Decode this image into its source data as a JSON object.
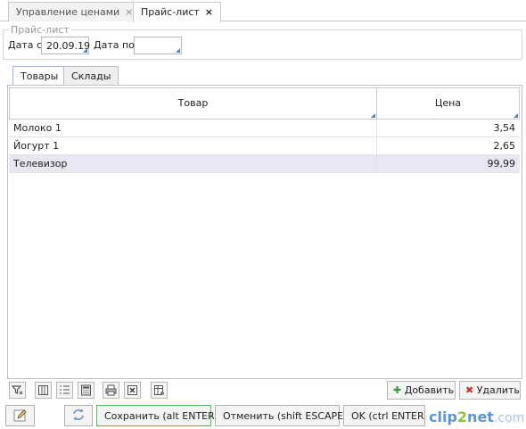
{
  "tabs": [
    {
      "label": "Управление ценами",
      "close": "×",
      "active": false
    },
    {
      "label": "Прайс-лист",
      "close": "×",
      "active": true
    }
  ],
  "form": {
    "legend": "Прайс-лист",
    "date_from_label": "Дата с",
    "date_from_value": "20.09.19",
    "date_to_label": "Дата по",
    "date_to_value": ""
  },
  "inner_tabs": [
    {
      "label": "Товары",
      "active": true
    },
    {
      "label": "Склады",
      "active": false
    }
  ],
  "grid": {
    "columns": [
      "Товар",
      "Цена"
    ],
    "rows": [
      {
        "item": "Молоко 1",
        "price": "3,54",
        "selected": false
      },
      {
        "item": "Йогурт 1",
        "price": "2,65",
        "selected": false
      },
      {
        "item": "Телевизор",
        "price": "99,99",
        "selected": true
      }
    ]
  },
  "toolbar": {
    "icons": [
      "filter-icon",
      "columns-icon",
      "numbered-list-icon",
      "calculator-icon",
      "print-icon",
      "excel-export-icon",
      "grid-settings-icon"
    ],
    "add_label": "Добавить",
    "delete_label": "Удалить"
  },
  "footer": {
    "save_label": "Сохранить (alt ENTER)",
    "cancel_label": "Отменить (shift ESCAPE)",
    "ok_label": "OK (ctrl ENTER"
  },
  "watermark": {
    "part1": "clip",
    "part2": "2",
    "part3": "net",
    "part4": ".com"
  },
  "colors": {
    "selected_row": "#e8e8f4",
    "save_border": "#4fc04f",
    "corner_marker": "#4a7fc4"
  }
}
